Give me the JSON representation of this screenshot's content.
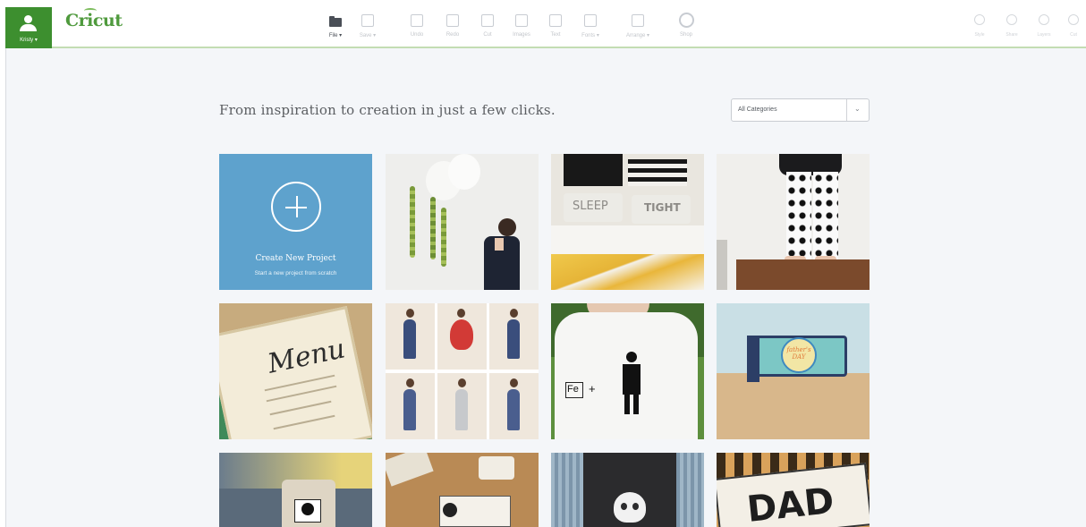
{
  "user": {
    "name": "Kristy ▾"
  },
  "brand": {
    "logo": "Cricut"
  },
  "toolbar": {
    "items": [
      {
        "label": "File ▾",
        "active": true
      },
      {
        "label": "Save ▾",
        "active": false
      },
      {
        "label": "Undo",
        "active": false
      },
      {
        "label": "Redo",
        "active": false
      },
      {
        "label": "Cut",
        "active": false
      },
      {
        "label": "Images",
        "active": false
      },
      {
        "label": "Text",
        "active": false
      },
      {
        "label": "Fonts ▾",
        "active": false
      },
      {
        "label": "Arrange ▾",
        "active": false
      },
      {
        "label": "Shop",
        "active": false
      }
    ],
    "right_items": [
      {
        "label": "Style"
      },
      {
        "label": "Share"
      },
      {
        "label": "Layers"
      },
      {
        "label": "Cut"
      }
    ]
  },
  "main": {
    "headline": "From inspiration to creation in just a few clicks.",
    "category_select": {
      "value": "All Categories"
    },
    "create_tile": {
      "title": "Create New Project",
      "subtitle": "Start a new project from scratch"
    },
    "project_images": [
      "Balloons with leaf garlands",
      "Sleep Tight pillows",
      "Polka heart leggings",
      "Menu card",
      "Girl dress collage",
      "Fe + man t-shirt",
      "Father's Day card",
      "Skull jar",
      "Poison label kit",
      "Skull apron",
      "DAD sign"
    ],
    "tile_texts": {
      "sleep": "SLEEP",
      "tight": "TIGHT",
      "menu": "Menu",
      "fe": "Fe",
      "plus": "+",
      "fathers": "father's DAY",
      "dad": "DAD"
    }
  },
  "colors": {
    "brand_green": "#3d8f2f",
    "create_blue": "#5ea2cd"
  }
}
